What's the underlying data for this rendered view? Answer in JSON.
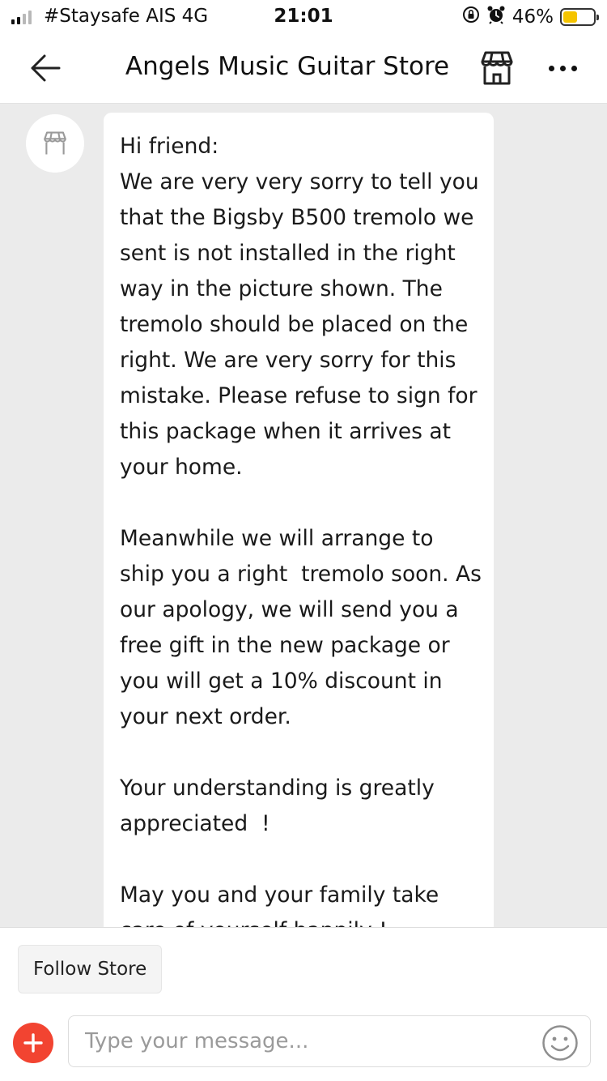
{
  "status_bar": {
    "carrier": "#Staysafe AIS  4G",
    "time": "21:01",
    "battery_text": "46%",
    "battery_level": 0.46,
    "battery_color": "#f5c400",
    "icons": [
      "signal-icon",
      "orientation-lock-icon",
      "alarm-icon",
      "battery-icon"
    ]
  },
  "header": {
    "back_icon": "arrow-left-icon",
    "title": "Angels Music Guitar Store",
    "store_icon": "storefront-icon",
    "more_icon": "more-horizontal-icon"
  },
  "chat": {
    "avatar_icon": "storefront-icon",
    "message": "Hi friend:\nWe are very very sorry to tell you that the Bigsby B500 tremolo we sent is not installed in the right way in the picture shown. The tremolo should be placed on the right. We are very sorry for this mistake. Please refuse to sign for this package when it arrives at your home.\n\nMeanwhile we will arrange to ship you a right  tremolo soon. As our apology, we will send you a free gift in the new package or you will get a 10% discount in your next order.\n\nYour understanding is greatly appreciated  !\n\nMay you and your family take care of yourself happily !"
  },
  "footer": {
    "follow_label": "Follow Store",
    "add_icon": "plus-icon",
    "add_color": "#f24431",
    "input_placeholder": "Type your message...",
    "input_value": "",
    "emoji_icon": "emoji-icon"
  }
}
